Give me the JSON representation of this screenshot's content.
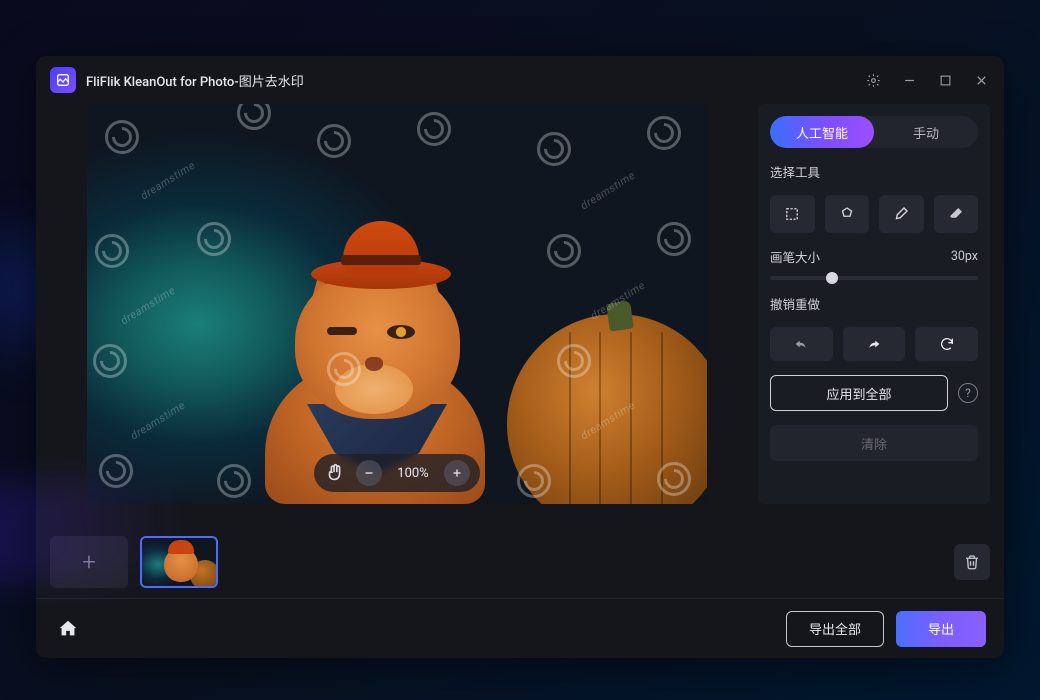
{
  "header": {
    "title": "FliFlik KleanOut for Photo-图片去水印"
  },
  "zoom": {
    "label": "100%"
  },
  "side": {
    "tabs": {
      "ai": "人工智能",
      "manual": "手动"
    },
    "select_tool": "选择工具",
    "brush_label": "画笔大小",
    "brush_value": "30px",
    "brush_percent": 30,
    "undo_label": "撤销重做",
    "apply_all": "应用到全部",
    "clear": "清除"
  },
  "footer": {
    "export_all": "导出全部",
    "export": "导出"
  },
  "watermark_text": "dreamstime"
}
